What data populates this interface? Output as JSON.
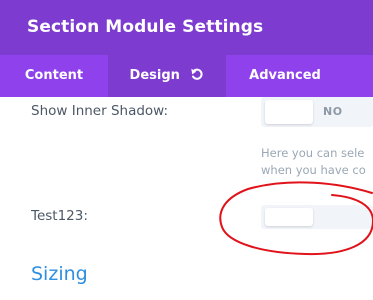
{
  "header": {
    "title": "Section Module Settings"
  },
  "tabs": [
    {
      "label": "Content"
    },
    {
      "label": "Design"
    },
    {
      "label": "Advanced"
    }
  ],
  "settings": {
    "inner_shadow": {
      "label": "Show Inner Shadow:",
      "value_text": "NO"
    },
    "help_lines": [
      "Here you can sele",
      "when you have co"
    ],
    "test": {
      "label": "Test123:"
    }
  },
  "sections": {
    "sizing": "Sizing"
  },
  "colors": {
    "header_bg": "#7e3bd0",
    "tabs_bg": "#8f42ec",
    "active_tab_bg": "#7e3bd0",
    "label": "#4c5866",
    "heading_accent": "#2f8fe0",
    "annotation": "#e0131a"
  },
  "icons": {
    "design_tab": "undo-icon"
  }
}
